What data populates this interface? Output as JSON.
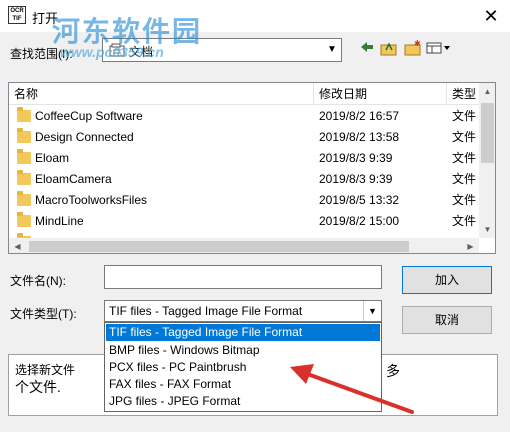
{
  "window": {
    "title": "打开",
    "app_icon_text": "OCR TIF",
    "close_glyph": "✕"
  },
  "watermark": {
    "main": "河东软件园",
    "url": "www.pc0359.cn"
  },
  "lookin": {
    "label": "查找范围(I):",
    "value": "文档"
  },
  "toolbar": [
    "back-arrow-icon",
    "up-folder-icon",
    "new-folder-icon",
    "view-menu-icon"
  ],
  "list": {
    "headers": {
      "name": "名称",
      "date": "修改日期",
      "type": "类型"
    },
    "rows": [
      {
        "name": "CoffeeCup Software",
        "date": "2019/8/2 16:57",
        "type": "文件"
      },
      {
        "name": "Design Connected",
        "date": "2019/8/2 13:58",
        "type": "文件"
      },
      {
        "name": "Eloam",
        "date": "2019/8/3 9:39",
        "type": "文件"
      },
      {
        "name": "EloamCamera",
        "date": "2019/8/3 9:39",
        "type": "文件"
      },
      {
        "name": "MacroToolworksFiles",
        "date": "2019/8/5 13:32",
        "type": "文件"
      },
      {
        "name": "MindLine",
        "date": "2019/8/2 15:00",
        "type": "文件"
      }
    ]
  },
  "form": {
    "filename_label": "文件名(N):",
    "filename_value": "",
    "filetype_label": "文件类型(T):",
    "filetype_value": "TIF files - Tagged Image File Format",
    "open_label": "加入",
    "cancel_label": "取消"
  },
  "filetype_options": [
    "TIF files - Tagged Image File Format",
    "BMP files - Windows Bitmap",
    "PCX files - PC Paintbrush",
    "FAX files - FAX Format",
    "JPG files - JPEG Format"
  ],
  "description": {
    "left": "选择新文件",
    "right": "多",
    "line2": "个文件."
  },
  "colors": {
    "selection": "#0078d7",
    "annotation_arrow": "#d9302a",
    "folder": "#f3c85a"
  }
}
